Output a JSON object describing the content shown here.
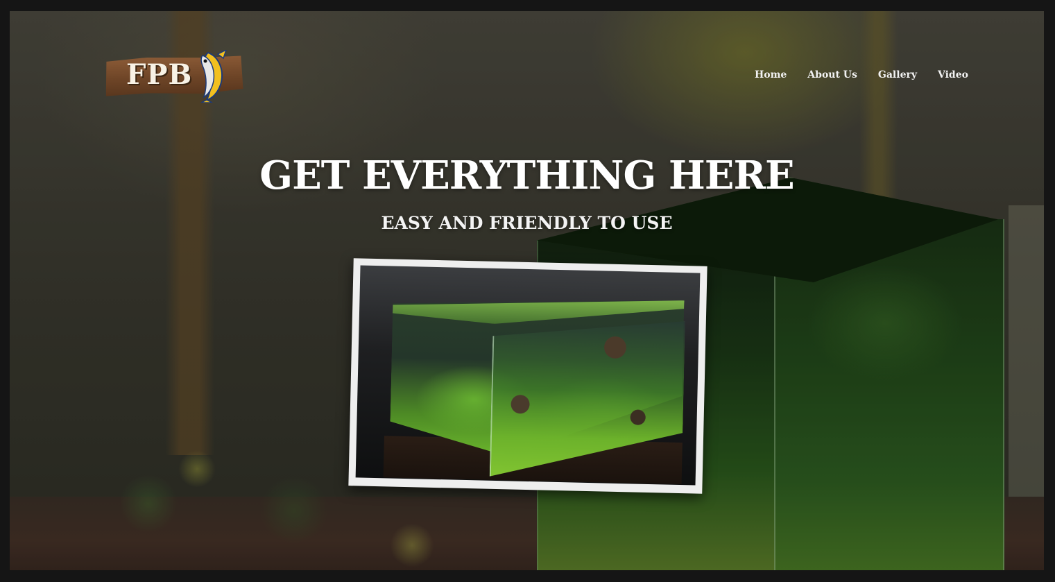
{
  "logo": {
    "text": "FPB"
  },
  "nav": {
    "items": [
      {
        "label": "Home"
      },
      {
        "label": "About Us"
      },
      {
        "label": "Gallery"
      },
      {
        "label": "Video"
      }
    ]
  },
  "hero": {
    "title": "GET EVERYTHING HERE",
    "subtitle": "EASY AND FRIENDLY TO USE"
  },
  "icons": {
    "logo_mascot": "fish-icon"
  },
  "colors": {
    "text": "#ffffff",
    "photo_frame": "#eeeeee",
    "page_border": "#151515"
  }
}
